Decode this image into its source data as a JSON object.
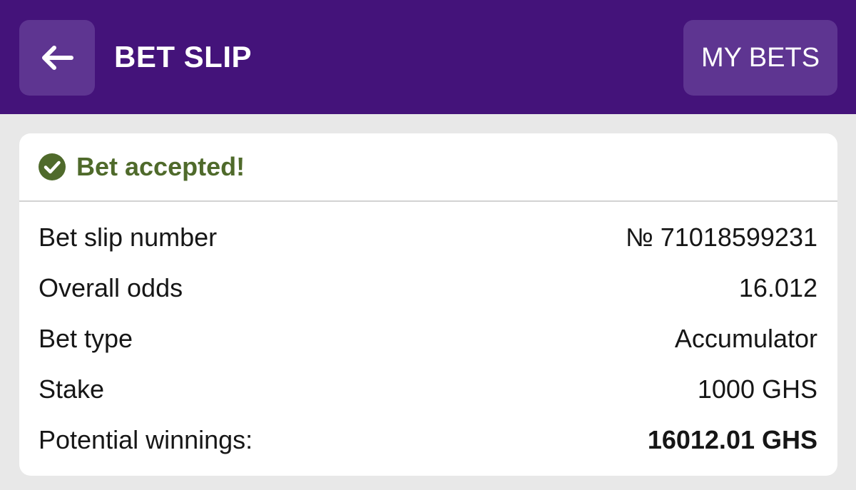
{
  "header": {
    "title": "BET SLIP",
    "my_bets_label": "MY BETS",
    "back_icon": "arrow-left-icon"
  },
  "status": {
    "icon": "check-circle-icon",
    "text": "Bet accepted!"
  },
  "details": [
    {
      "label": "Bet slip number",
      "value": "№ 71018599231"
    },
    {
      "label": "Overall odds",
      "value": "16.012"
    },
    {
      "label": "Bet type",
      "value": "Accumulator"
    },
    {
      "label": "Stake",
      "value": "1000 GHS"
    },
    {
      "label": "Potential winnings:",
      "value": "16012.01 GHS"
    }
  ],
  "colors": {
    "header_bg": "#44137a",
    "button_bg": "#5e3591",
    "success_green": "#4f6a2b"
  }
}
